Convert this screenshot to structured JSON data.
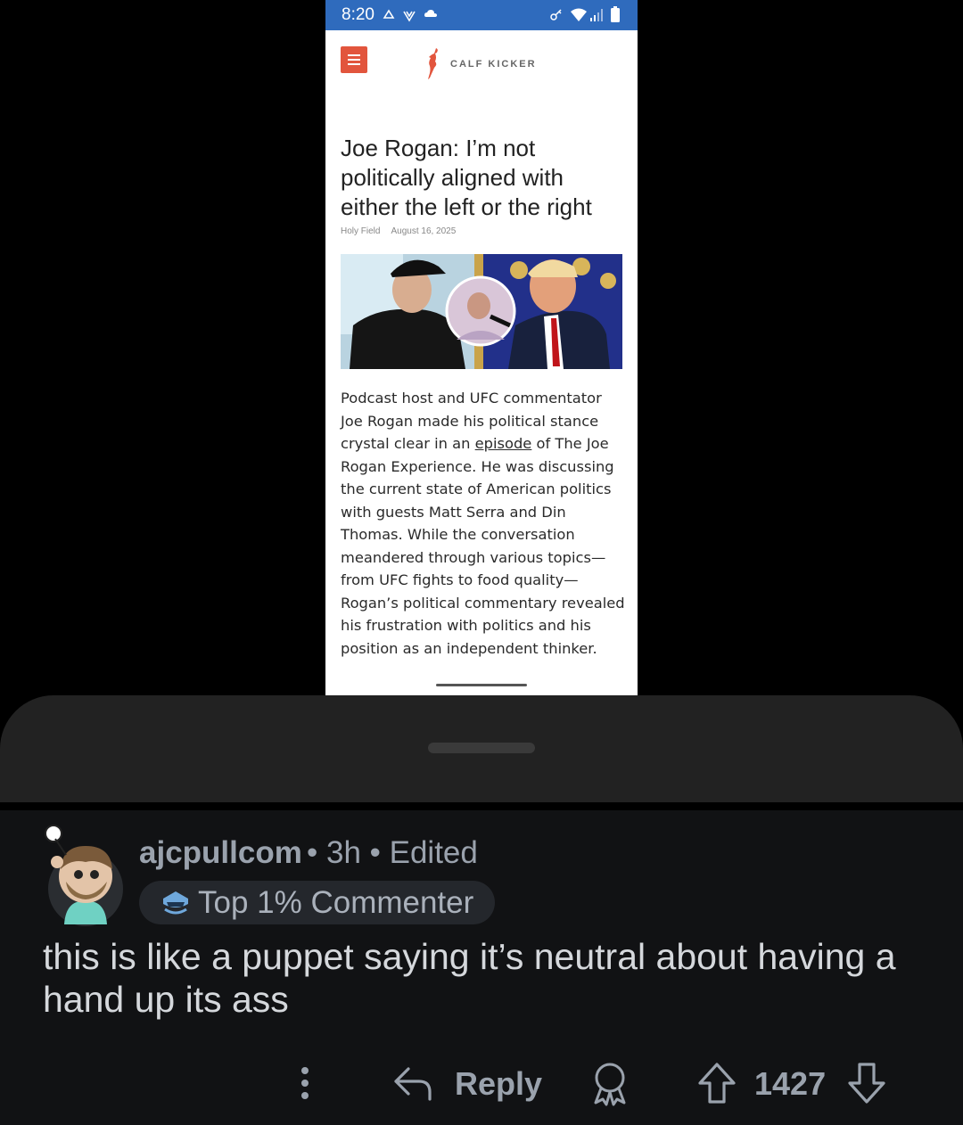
{
  "phone": {
    "status_time": "8:20",
    "brand": "CALF KICKER",
    "headline": "Joe Rogan: I’m not politically aligned with either the left or the right",
    "byline_author": "Holy Field",
    "byline_date": "August 16, 2025",
    "article_pre_link": "Podcast host and UFC commentator Joe Rogan made his political stance crystal clear in an ",
    "article_link": "episode",
    "article_post_link": " of The Joe Rogan Experience. He was discussing the current state of American politics with guests Matt Serra and Din Thomas. While the conversation meandered through various topics—from UFC fights to food quality—Rogan’s political commentary revealed his frustration with politics and his position as an independent thinker.",
    "colors": {
      "status_bar": "#2f6bbd",
      "menu_button": "#e2553d",
      "logo": "#e2553d"
    }
  },
  "comment": {
    "username": "ajcpullcom",
    "time": "3h",
    "edited": "Edited",
    "flair": "Top 1% Commenter",
    "body": "this is like a puppet saying it’s neutral about having a hand up its ass",
    "reply_label": "Reply",
    "score": "1427",
    "icons": [
      "more-icon",
      "reply-icon",
      "award-icon",
      "upvote-icon",
      "downvote-icon"
    ]
  }
}
